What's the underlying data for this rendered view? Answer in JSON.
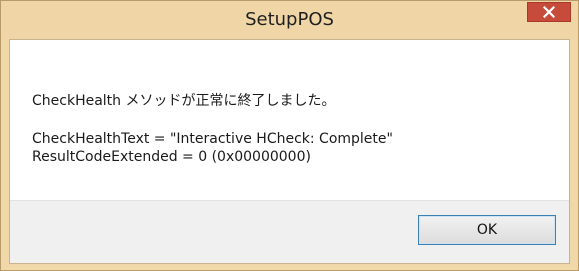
{
  "window": {
    "title": "SetupPOS"
  },
  "message": {
    "line1": "CheckHealth メソッドが正常に終了しました。",
    "line2": "CheckHealthText = \"Interactive HCheck: Complete\"",
    "line3": "ResultCodeExtended = 0 (0x00000000)"
  },
  "buttons": {
    "ok_label": "OK"
  },
  "colors": {
    "titlebar": "#f0d6a6",
    "close_button": "#c74b3b",
    "footer": "#f0f0f0",
    "content": "#ffffff"
  },
  "icons": {
    "close": "close-icon"
  }
}
